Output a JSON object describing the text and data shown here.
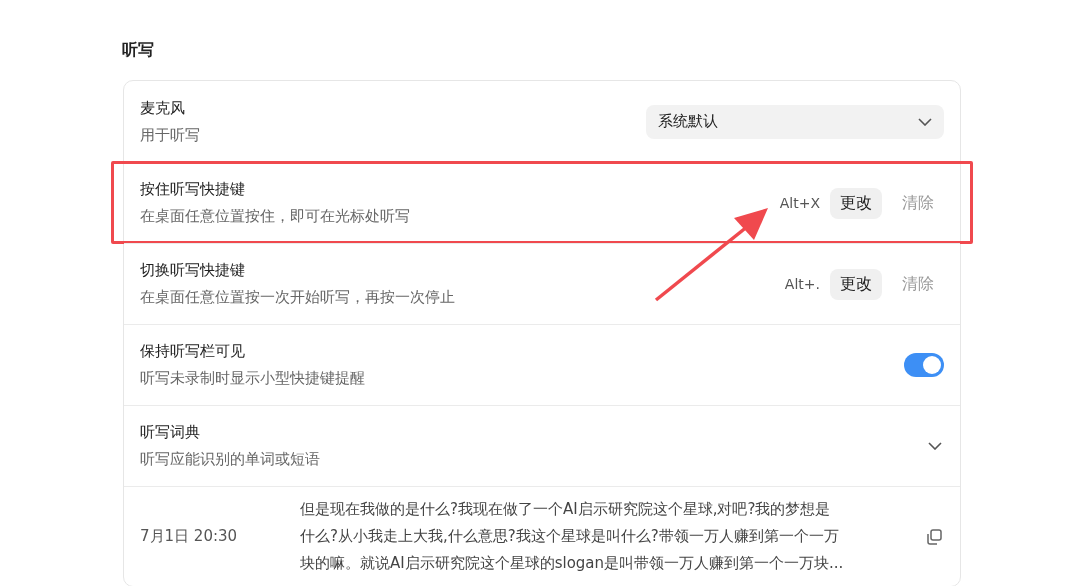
{
  "section_title": "听写",
  "settings": [
    {
      "kind": "select",
      "title": "麦克风",
      "description": "用于听写",
      "value": "系统默认"
    },
    {
      "kind": "shortcut",
      "title": "按住听写快捷键",
      "description": "在桌面任意位置按住，即可在光标处听写",
      "shortcut": "Alt+X",
      "change_label": "更改",
      "clear_label": "清除",
      "highlighted": true
    },
    {
      "kind": "shortcut",
      "title": "切换听写快捷键",
      "description": "在桌面任意位置按一次开始听写，再按一次停止",
      "shortcut": "Alt+.",
      "change_label": "更改",
      "clear_label": "清除",
      "highlighted": false
    },
    {
      "kind": "toggle",
      "title": "保持听写栏可见",
      "description": "听写未录制时显示小型快捷键提醒",
      "on": true
    },
    {
      "kind": "expand",
      "title": "听写词典",
      "description": "听写应能识别的单词或短语",
      "expanded": false
    },
    {
      "kind": "history",
      "time": "7月1日 20:30",
      "text": "但是现在我做的是什么?我现在做了一个AI启示研究院这个星球,对吧?我的梦想是什么?从小我走上大我,什么意思?我这个星球是叫什么?带领一万人赚到第一个一万块的嘛。就说AI启示研究院这个星球的slogan是叫带领一万人赚到第一个一万块..."
    }
  ]
}
